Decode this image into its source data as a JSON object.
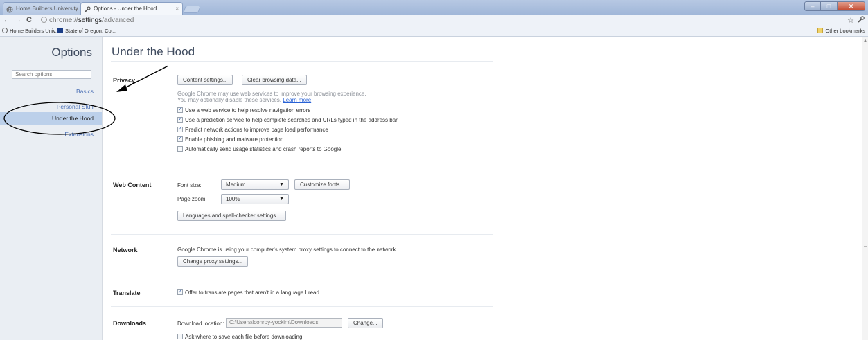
{
  "browser": {
    "tabs": [
      {
        "title": "Home Builders University",
        "active": false
      },
      {
        "title": "Options - Under the Hood",
        "active": true
      }
    ],
    "address_scheme": "chrome://",
    "address_host": "settings",
    "address_path": "/advanced",
    "bookmarks": [
      {
        "label": "Home Builders Univ...",
        "icon": "globe-icon"
      },
      {
        "label": "State of Oregon: Co...",
        "icon": "state-seal-icon"
      }
    ],
    "other_bookmarks": "Other bookmarks"
  },
  "sidebar": {
    "title": "Options",
    "search_placeholder": "Search options",
    "items": [
      {
        "label": "Basics",
        "selected": false
      },
      {
        "label": "Personal Stuff",
        "selected": false
      },
      {
        "label": "Under the Hood",
        "selected": true
      },
      {
        "label": "Extensions",
        "selected": false
      }
    ]
  },
  "page": {
    "title": "Under the Hood",
    "privacy": {
      "label": "Privacy",
      "content_settings_button": "Content settings...",
      "clear_data_button": "Clear browsing data...",
      "info_line1": "Google Chrome may use web services to improve your browsing experience.",
      "info_line2": "You may optionally disable these services.",
      "learn_more": "Learn more",
      "checkboxes": [
        {
          "label": "Use a web service to help resolve navigation errors",
          "checked": true
        },
        {
          "label": "Use a prediction service to help complete searches and URLs typed in the address bar",
          "checked": true
        },
        {
          "label": "Predict network actions to improve page load performance",
          "checked": true
        },
        {
          "label": "Enable phishing and malware protection",
          "checked": true
        },
        {
          "label": "Automatically send usage statistics and crash reports to Google",
          "checked": false
        }
      ]
    },
    "web_content": {
      "label": "Web Content",
      "font_size_label": "Font size:",
      "font_size_value": "Medium",
      "customize_fonts_button": "Customize fonts...",
      "page_zoom_label": "Page zoom:",
      "page_zoom_value": "100%",
      "languages_button": "Languages and spell-checker settings..."
    },
    "network": {
      "label": "Network",
      "description": "Google Chrome is using your computer's system proxy settings to connect to the network.",
      "proxy_button": "Change proxy settings..."
    },
    "translate": {
      "label": "Translate",
      "checkbox_label": "Offer to translate pages that aren't in a language I read",
      "checked": true
    },
    "downloads": {
      "label": "Downloads",
      "location_label": "Download location:",
      "location_value": "C:\\Users\\lconroy-yockim\\Downloads",
      "change_button": "Change...",
      "ask_label": "Ask where to save each file before downloading",
      "ask_checked": false
    }
  },
  "colors": {
    "annotation": "#000000",
    "selected_nav": "#bcd0ea",
    "link": "#4a6fb5"
  }
}
